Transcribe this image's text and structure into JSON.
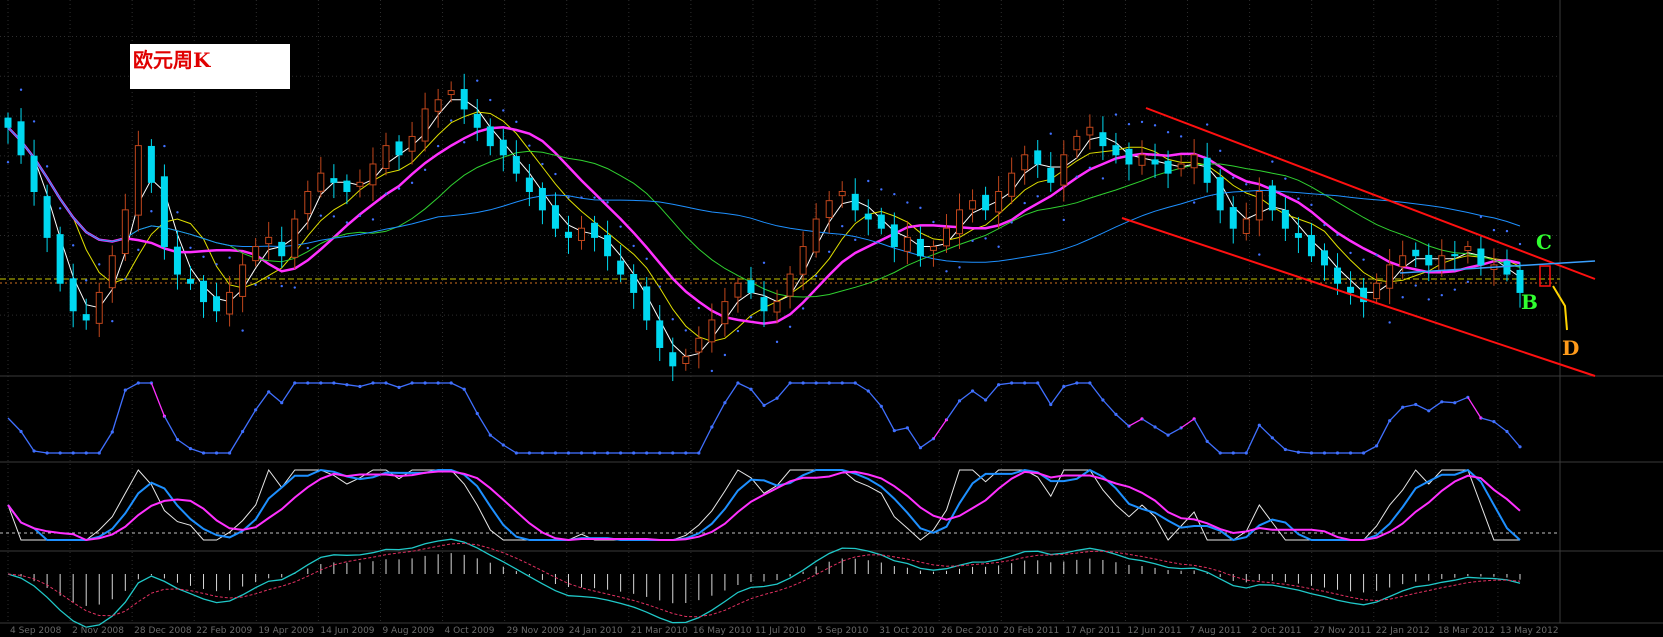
{
  "chart_data": {
    "type": "candlestick",
    "title": "欧元周K",
    "header": "",
    "x_labels": [
      "4 Sep 2008",
      "2 Nov 2008",
      "28 Dec 2008",
      "22 Feb 2009",
      "19 Apr 2009",
      "14 Jun 2009",
      "9 Aug 2009",
      "4 Oct 2009",
      "29 Nov 2009",
      "24 Jan 2010",
      "21 Mar 2010",
      "16 May 2010",
      "11 Jul 2010",
      "5 Sep 2010",
      "31 Oct 2010",
      "26 Dec 2010",
      "20 Feb 2011",
      "17 Apr 2011",
      "12 Jun 2011",
      "7 Aug 2011",
      "2 Oct 2011",
      "27 Nov 2011",
      "22 Jan 2012",
      "18 Mar 2012",
      "13 May 2012"
    ],
    "price_axis": {
      "ylim": [
        1.2,
        1.6
      ],
      "ticks": []
    },
    "wave_labels": {
      "B": "B",
      "C": "C",
      "D": "D"
    },
    "close": [
      1.47,
      1.44,
      1.4,
      1.35,
      1.3,
      1.27,
      1.26,
      1.29,
      1.33,
      1.38,
      1.45,
      1.41,
      1.34,
      1.31,
      1.3,
      1.28,
      1.27,
      1.29,
      1.32,
      1.34,
      1.35,
      1.33,
      1.37,
      1.4,
      1.42,
      1.41,
      1.4,
      1.41,
      1.43,
      1.45,
      1.44,
      1.46,
      1.49,
      1.5,
      1.51,
      1.49,
      1.47,
      1.45,
      1.44,
      1.42,
      1.4,
      1.38,
      1.36,
      1.35,
      1.36,
      1.35,
      1.33,
      1.31,
      1.29,
      1.26,
      1.23,
      1.21,
      1.22,
      1.24,
      1.26,
      1.28,
      1.3,
      1.29,
      1.27,
      1.28,
      1.31,
      1.34,
      1.37,
      1.39,
      1.4,
      1.38,
      1.37,
      1.36,
      1.34,
      1.35,
      1.33,
      1.34,
      1.36,
      1.38,
      1.39,
      1.38,
      1.4,
      1.42,
      1.44,
      1.43,
      1.41,
      1.44,
      1.46,
      1.47,
      1.45,
      1.44,
      1.43,
      1.44,
      1.43,
      1.42,
      1.43,
      1.44,
      1.41,
      1.38,
      1.36,
      1.37,
      1.4,
      1.38,
      1.36,
      1.35,
      1.33,
      1.32,
      1.3,
      1.29,
      1.28,
      1.3,
      1.32,
      1.33,
      1.33,
      1.32,
      1.33,
      1.33,
      1.34,
      1.32,
      1.32,
      1.31,
      1.29
    ]
  },
  "indicators": {
    "ind1_label": "",
    "ind1_ticks": [],
    "ind2_label": "",
    "ind2_ticks": [],
    "ind3_label": "",
    "ind3_ticks": []
  },
  "colors": {
    "bg": "#000000",
    "grid": "#2e2e2e",
    "up": "#c0461c",
    "down": "#00d8f0",
    "ma_white": "#ffffff",
    "ma_yellow": "#e0e000",
    "ma_magenta": "#ff30ff",
    "ma_green": "#30d030",
    "ma_blue": "#1e90ff",
    "sar": "#4070ff",
    "channel": "#ff1010",
    "label_B": "#30ff30",
    "label_C": "#30ff30",
    "label_D": "#ff9a1a",
    "hline": "#c8c800"
  }
}
